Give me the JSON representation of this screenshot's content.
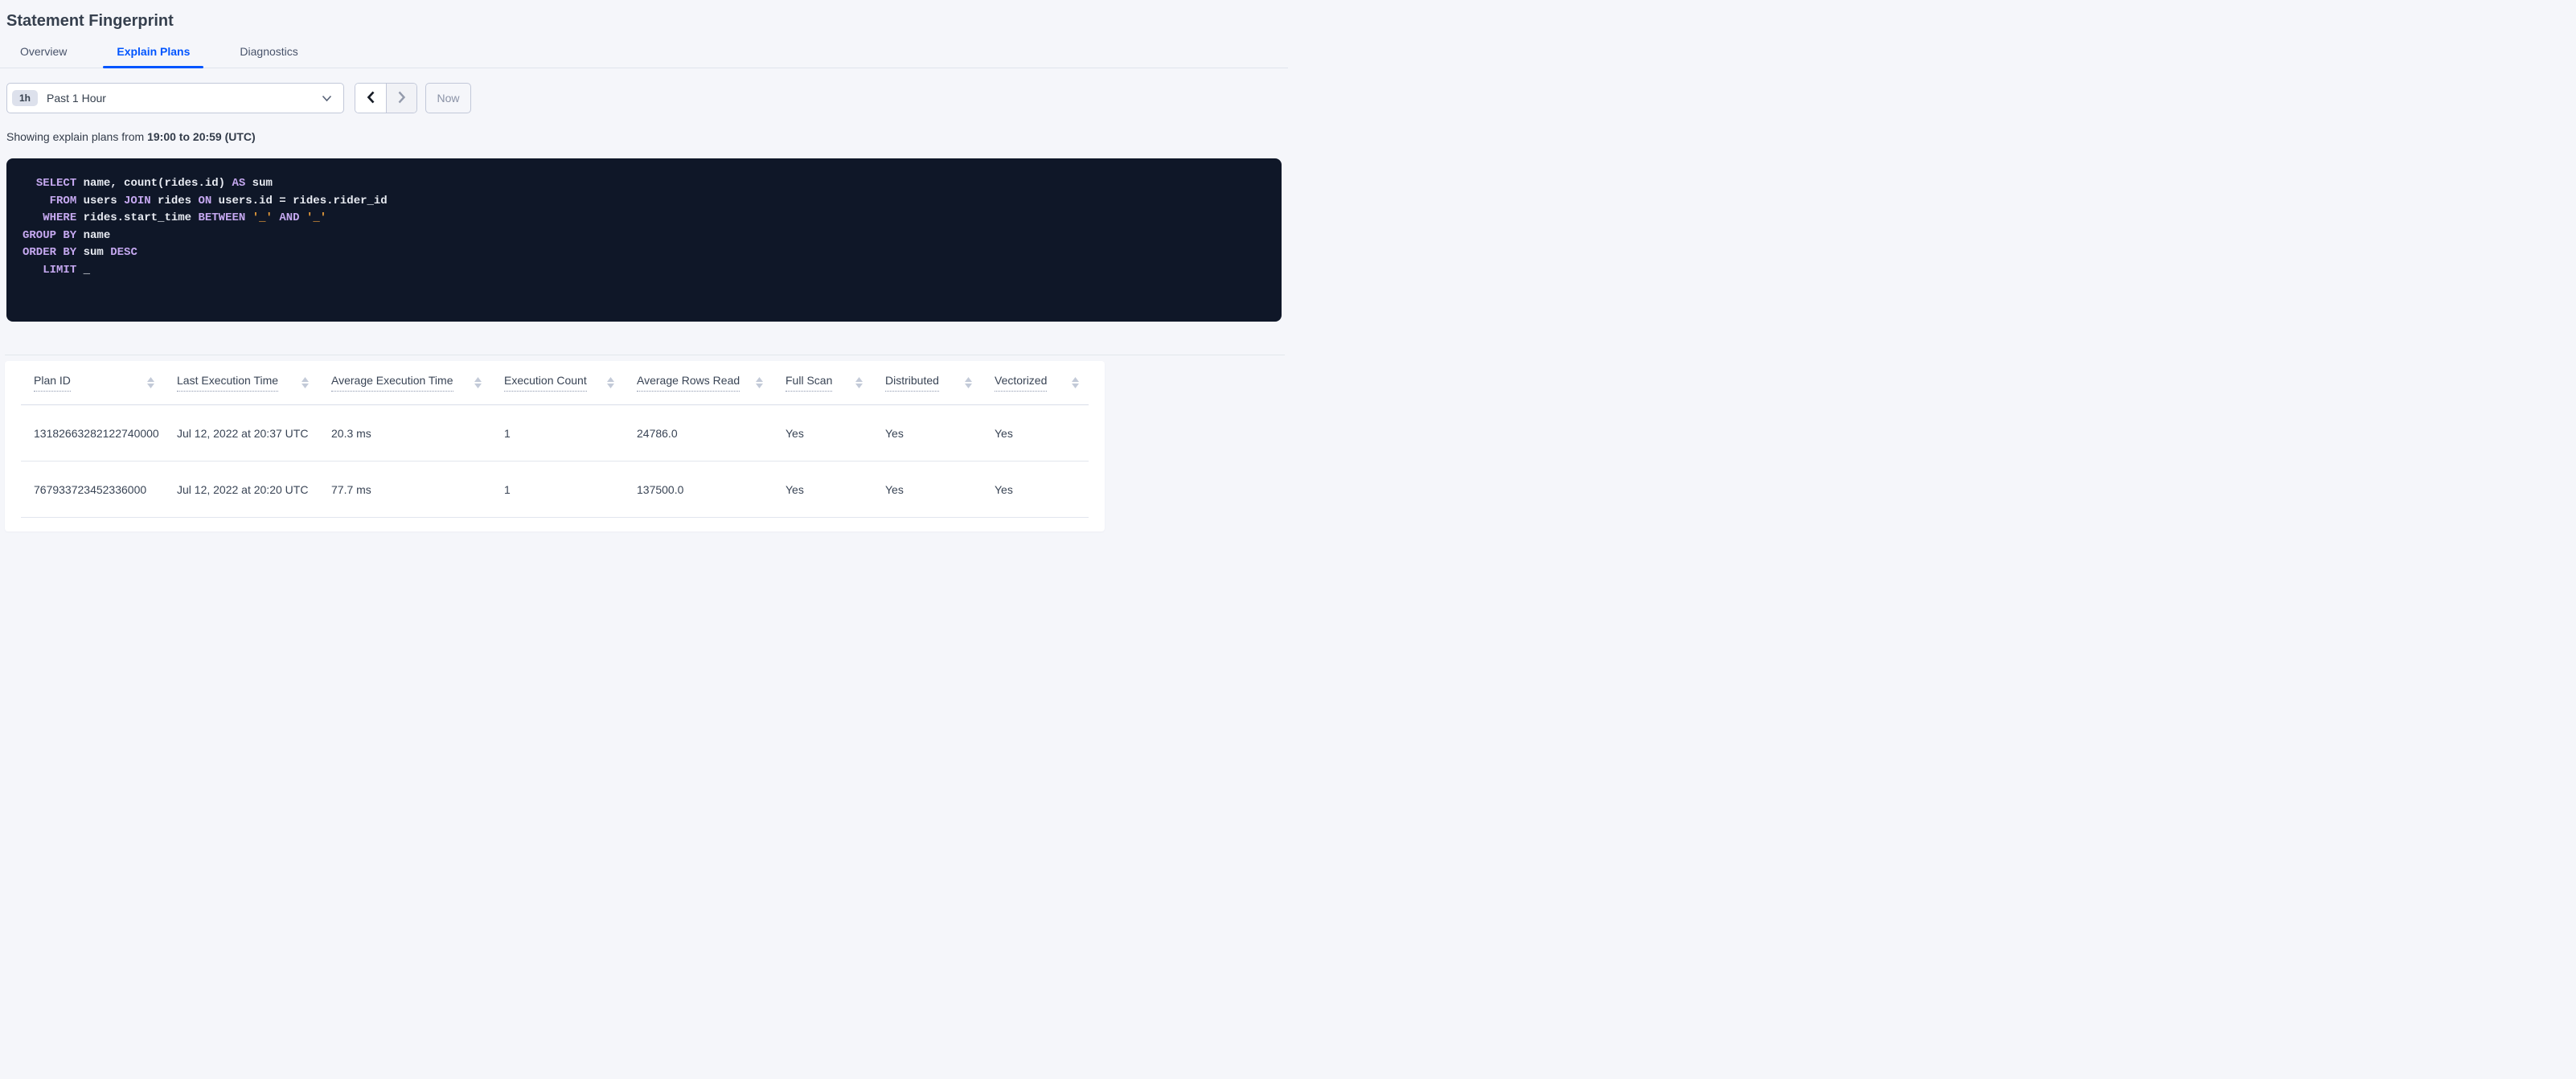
{
  "title": "Statement Fingerprint",
  "tabs": [
    {
      "label": "Overview",
      "active": false
    },
    {
      "label": "Explain Plans",
      "active": true
    },
    {
      "label": "Diagnostics",
      "active": false
    }
  ],
  "time_picker": {
    "badge": "1h",
    "selected": "Past 1 Hour",
    "now_label": "Now"
  },
  "showing": {
    "prefix": "Showing explain plans from ",
    "range": "19:00 to 20:59 (UTC)"
  },
  "sql": {
    "lines": [
      [
        {
          "t": "pl",
          "s": "  "
        },
        {
          "t": "kw",
          "s": "SELECT"
        },
        {
          "t": "pl",
          "s": " name, count(rides.id) "
        },
        {
          "t": "kw",
          "s": "AS"
        },
        {
          "t": "pl",
          "s": " sum"
        }
      ],
      [
        {
          "t": "pl",
          "s": "    "
        },
        {
          "t": "kw",
          "s": "FROM"
        },
        {
          "t": "pl",
          "s": " users "
        },
        {
          "t": "kw",
          "s": "JOIN"
        },
        {
          "t": "pl",
          "s": " rides "
        },
        {
          "t": "kw",
          "s": "ON"
        },
        {
          "t": "pl",
          "s": " users.id = rides.rider_id"
        }
      ],
      [
        {
          "t": "pl",
          "s": "   "
        },
        {
          "t": "kw",
          "s": "WHERE"
        },
        {
          "t": "pl",
          "s": " rides.start_time "
        },
        {
          "t": "kw",
          "s": "BETWEEN"
        },
        {
          "t": "pl",
          "s": " "
        },
        {
          "t": "lit",
          "s": "'_'"
        },
        {
          "t": "pl",
          "s": " "
        },
        {
          "t": "kw",
          "s": "AND"
        },
        {
          "t": "pl",
          "s": " "
        },
        {
          "t": "lit",
          "s": "'_'"
        }
      ],
      [
        {
          "t": "kw",
          "s": "GROUP BY"
        },
        {
          "t": "pl",
          "s": " name"
        }
      ],
      [
        {
          "t": "kw",
          "s": "ORDER BY"
        },
        {
          "t": "pl",
          "s": " sum "
        },
        {
          "t": "kw",
          "s": "DESC"
        }
      ],
      [
        {
          "t": "pl",
          "s": "   "
        },
        {
          "t": "kw",
          "s": "LIMIT"
        },
        {
          "t": "pl",
          "s": " _"
        }
      ]
    ],
    "colors": {
      "background": "#0f1728",
      "keyword": "#c5a8f0",
      "plain": "#e8ebf2",
      "literal": "#efa13b"
    }
  },
  "table": {
    "columns": [
      "Plan ID",
      "Last Execution Time",
      "Average Execution Time",
      "Execution Count",
      "Average Rows Read",
      "Full Scan",
      "Distributed",
      "Vectorized"
    ],
    "rows": [
      [
        "13182663282122740000",
        "Jul 12, 2022 at 20:37 UTC",
        "20.3 ms",
        "1",
        "24786.0",
        "Yes",
        "Yes",
        "Yes"
      ],
      [
        "767933723452336000",
        "Jul 12, 2022 at 20:20 UTC",
        "77.7 ms",
        "1",
        "137500.0",
        "Yes",
        "Yes",
        "Yes"
      ]
    ]
  },
  "colors": {
    "accent": "#0055ff",
    "background": "#f5f6fa",
    "text": "#394455"
  }
}
